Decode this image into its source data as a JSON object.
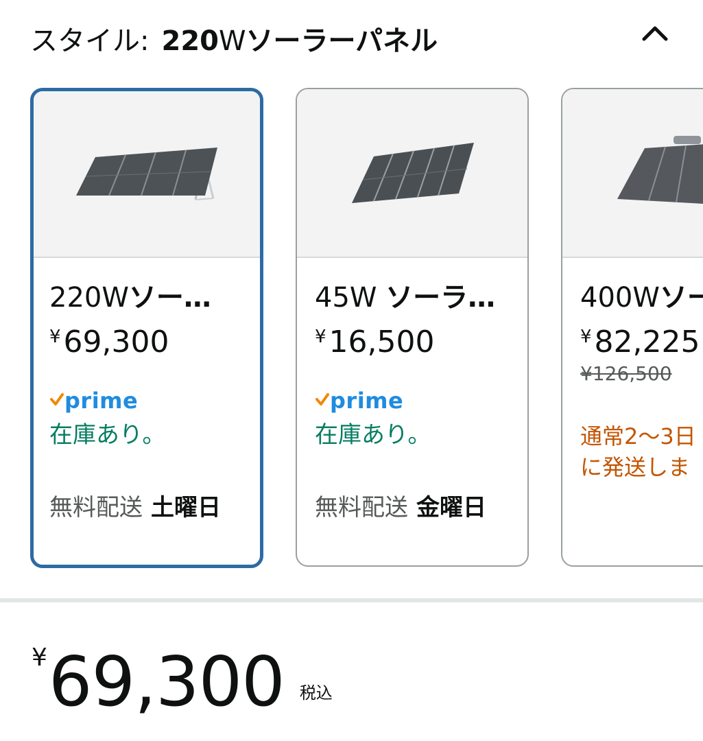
{
  "style_selector": {
    "label": "スタイル:",
    "selected_prefix": "220",
    "selected_w": "W",
    "selected_suffix": "ソーラーパネル",
    "collapse_icon": "chevron-up-icon"
  },
  "options": [
    {
      "title_prefix": "220W",
      "title_bold": "ソー…",
      "currency": "¥",
      "price": "69,300",
      "prime_label": "prime",
      "stock": "在庫あり。",
      "delivery_label": "無料配送",
      "delivery_day": "土曜日",
      "selected": true
    },
    {
      "title_prefix": "45W ",
      "title_bold": "ソーラ…",
      "currency": "¥",
      "price": "16,500",
      "prime_label": "prime",
      "stock": "在庫あり。",
      "delivery_label": "無料配送",
      "delivery_day": "金曜日",
      "selected": false
    },
    {
      "title_prefix": "400W",
      "title_bold": "ソー",
      "currency": "¥",
      "price": "82,225",
      "list_price": "¥126,500",
      "shipping_line1": "通常2〜3日",
      "shipping_line2": "に発送しま",
      "selected": false
    }
  ],
  "buybox": {
    "currency": "¥",
    "price": "69,300",
    "tax_note": "税込"
  },
  "colors": {
    "selected_border": "#2c6ba4",
    "prime_blue": "#1f8ce0",
    "prime_check": "#f08804",
    "in_stock_green": "#067d62",
    "shipping_orange": "#c45500"
  }
}
